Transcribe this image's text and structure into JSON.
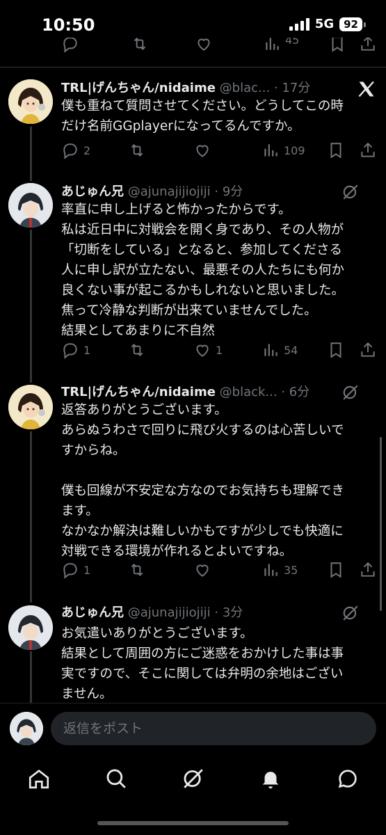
{
  "status_bar": {
    "time": "10:50",
    "network": "5G",
    "battery": "92"
  },
  "prev_post": {
    "views": "45"
  },
  "posts": [
    {
      "name": "TRL|げんちゃん/nidaime",
      "handle": "@blac...",
      "time": "17分",
      "lines": [
        "僕も重ねて質問させてください。どうしてこの時",
        "だけ名前GGplayerになってるんですか。"
      ],
      "replies": "2",
      "reposts": "",
      "likes": "",
      "views": "109",
      "corner_icon": "x-logo-icon"
    },
    {
      "name": "あじゅん兄",
      "handle": "@ajunajijiojiji",
      "time": "9分",
      "lines": [
        "率直に申し上げると怖かったからです。",
        "私は近日中に対戦会を開く身であり、その人物が",
        "「切断をしている」となると、参加してくださる",
        "人に申し訳が立たない、最悪その人たちにも何か",
        "良くない事が起こるかもしれないと思いました。",
        "焦って冷静な判断が出来ていませんでした。",
        "結果としてあまりに不自然"
      ],
      "replies": "1",
      "reposts": "",
      "likes": "1",
      "views": "54",
      "corner_icon": "grok-icon"
    },
    {
      "name": "TRL|げんちゃん/nidaime",
      "handle": "@black...",
      "time": "6分",
      "lines": [
        "返答ありがとうございます。",
        "あらぬうわさで回りに飛び火するのは心苦しいで",
        "すからね。",
        "",
        "僕も回線が不安定な方なのでお気持ちも理解でき",
        "ます。",
        "なかなか解決は難しいかもですが少しでも快適に",
        "対戦できる環境が作れるとよいですね。"
      ],
      "replies": "1",
      "reposts": "",
      "likes": "",
      "views": "35",
      "corner_icon": "grok-icon"
    },
    {
      "name": "あじゅん兄",
      "handle": "@ajunajijiojiji",
      "time": "3分",
      "lines": [
        "お気遣いありがとうございます。",
        "結果として周囲の方にご迷惑をおかけした事は事",
        "実ですので、そこに関しては弁明の余地はござい",
        "ません。"
      ],
      "corner_icon": "grok-icon"
    }
  ],
  "reply_bar": {
    "placeholder": "返信をポスト"
  },
  "tabs": [
    "home-icon",
    "search-icon",
    "grok-icon",
    "notifications-icon",
    "messages-icon"
  ]
}
